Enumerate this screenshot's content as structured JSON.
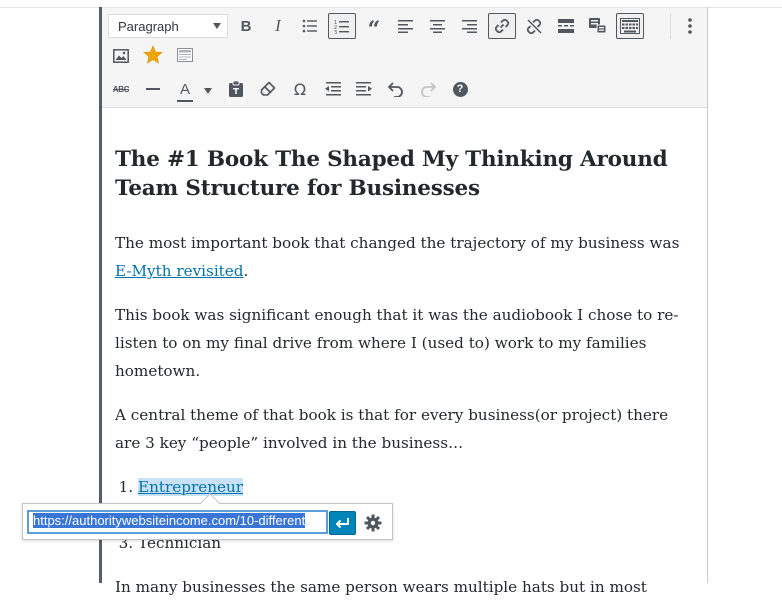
{
  "toolbar": {
    "format_select": {
      "value": "Paragraph"
    },
    "row1_buttons": [
      "bold-icon",
      "italic-icon",
      "bulleted-list-icon",
      "numbered-list-icon",
      "blockquote-icon",
      "align-left-icon",
      "align-center-icon",
      "align-right-icon",
      "insert-link-icon",
      "remove-link-icon",
      "read-more-icon",
      "toolbar-toggle-icon",
      "keyboard-icon",
      "more-options-icon"
    ],
    "row2_buttons": [
      "add-media-icon",
      "star-icon",
      "insert-page-icon"
    ],
    "row3_buttons": [
      "strikethrough-icon",
      "horizontal-line-icon",
      "text-color-icon",
      "paste-text-icon",
      "clear-formatting-icon",
      "special-character-icon",
      "decrease-indent-icon",
      "increase-indent-icon",
      "undo-icon",
      "redo-icon",
      "help-icon"
    ],
    "text_color_letter": "A",
    "omega": "Ω",
    "strike_label": "ABC",
    "help_label": "?"
  },
  "content": {
    "heading": "The #1 Book The Shaped My Thinking Around Team Structure for Businesses",
    "p1_before": "The most important book that changed the trajectory of my business was ",
    "p1_link": "E-Myth revisited",
    "p1_after": ".",
    "p2": "This book was significant enough that it was the audiobook I chose to re-listen to on my final drive from where I (used to) work to my families hometown.",
    "p3": "A central theme of that book is that for every business(or project) there are 3 key “people” involved in the business…",
    "list_item_1": "Entrepreneur",
    "list_item_3": "Technician",
    "p4_partial": "In many businesses the same person wears multiple hats but in most"
  },
  "link_popover": {
    "url_value": "https://authoritywebsiteincome.com/10-different"
  },
  "colors": {
    "accent": "#0085ba",
    "link": "#0073aa",
    "selection": "#c8e1f5",
    "star": "#f0a600"
  }
}
